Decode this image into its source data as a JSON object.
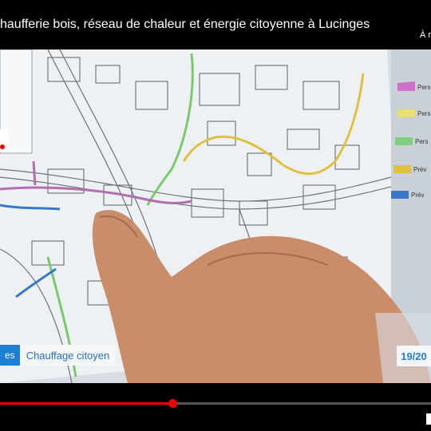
{
  "video": {
    "title": "haufferie bois, réseau de chaleur et énergie citoyenne à Lucinges",
    "share_label": "À r"
  },
  "map": {
    "legend": [
      {
        "color": "#d070c8",
        "label": "Pers"
      },
      {
        "color": "#e8e070",
        "label": "Pers"
      },
      {
        "color": "#80d080",
        "label": "Pers"
      },
      {
        "color": "#e0c040",
        "label": "Prév"
      },
      {
        "color": "#3a78c8",
        "label": "Prév"
      }
    ]
  },
  "lower_third": {
    "tag": "es",
    "caption": "Chauffage citoyen"
  },
  "channel": {
    "logo": "19/20"
  },
  "player": {
    "progress_fraction": 0.4
  }
}
